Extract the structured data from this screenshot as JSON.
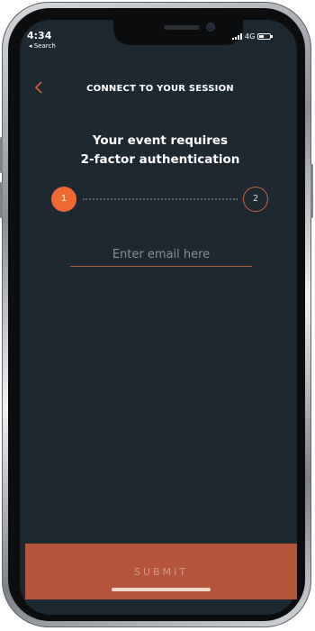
{
  "status_bar": {
    "time": "4:34",
    "back_app": "◂ Search",
    "network": "4G"
  },
  "header": {
    "back_icon": "chevron-left-icon",
    "title": "CONNECT TO YOUR SESSION"
  },
  "headline": {
    "line1": "Your event requires",
    "line2": "2-factor authentication"
  },
  "stepper": {
    "steps": [
      "1",
      "2"
    ],
    "active_step": 1
  },
  "email": {
    "placeholder": "Enter email here",
    "value": ""
  },
  "submit": {
    "label": "SUBMIT"
  },
  "colors": {
    "background": "#1e2831",
    "accent": "#ee6a34",
    "button": "#b4543a"
  }
}
